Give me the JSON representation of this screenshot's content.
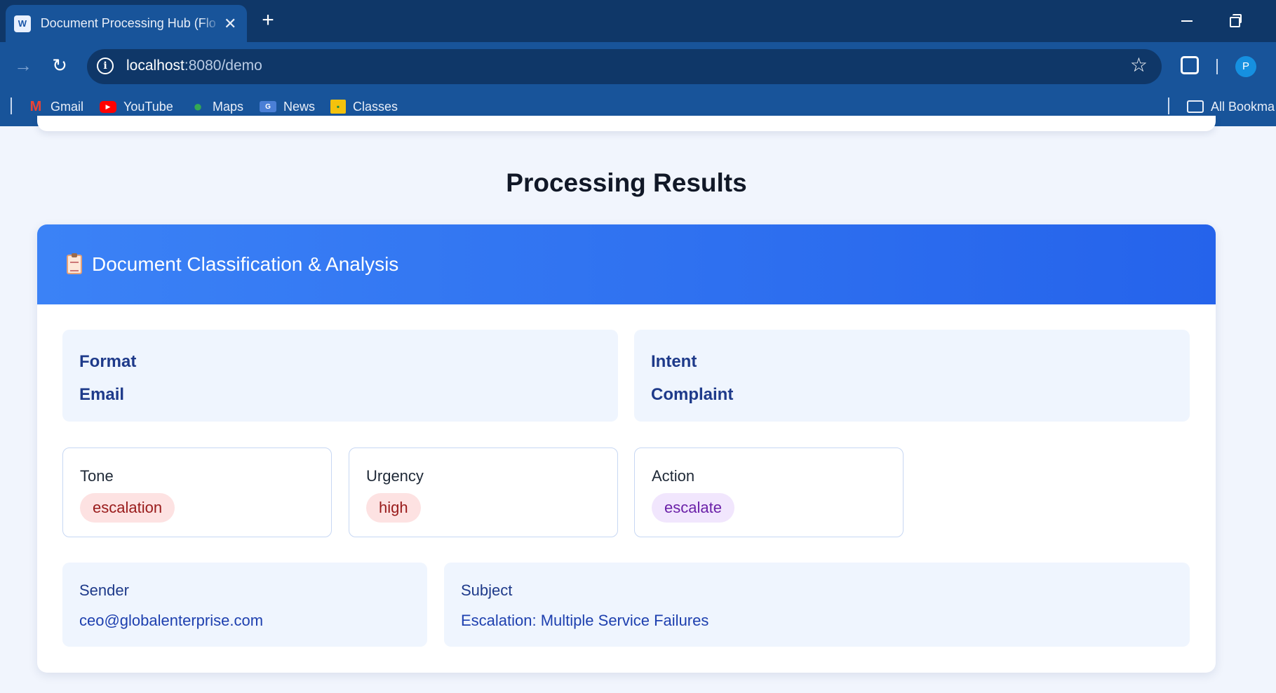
{
  "browser": {
    "tab_title": "Document Processing Hub (Flo",
    "tab_favicon": "W",
    "url_host": "localhost",
    "url_rest": ":8080/demo",
    "avatar_letter": "P",
    "bookmarks": [
      {
        "label": "Gmail",
        "icon": "gmail-icon"
      },
      {
        "label": "YouTube",
        "icon": "youtube-icon"
      },
      {
        "label": "Maps",
        "icon": "maps-icon"
      },
      {
        "label": "News",
        "icon": "news-icon"
      },
      {
        "label": "Classes",
        "icon": "classes-icon"
      }
    ],
    "all_bookmarks": "All Bookma"
  },
  "page": {
    "title": "Processing Results",
    "card_title": "Document Classification & Analysis",
    "format": {
      "label": "Format",
      "value": "Email"
    },
    "intent": {
      "label": "Intent",
      "value": "Complaint"
    },
    "tone": {
      "label": "Tone",
      "value": "escalation"
    },
    "urgency": {
      "label": "Urgency",
      "value": "high"
    },
    "action": {
      "label": "Action",
      "value": "escalate"
    },
    "sender": {
      "label": "Sender",
      "value": "ceo@globalenterprise.com"
    },
    "subject": {
      "label": "Subject",
      "value": "Escalation: Multiple Service Failures"
    }
  },
  "colors": {
    "tab_bar": "#0f3768",
    "toolbar": "#18549a",
    "header_gradient_start": "#3b82f6",
    "header_gradient_end": "#2563eb",
    "pill_red_bg": "#fde2e2",
    "pill_purple_bg": "#f1e6fd"
  }
}
